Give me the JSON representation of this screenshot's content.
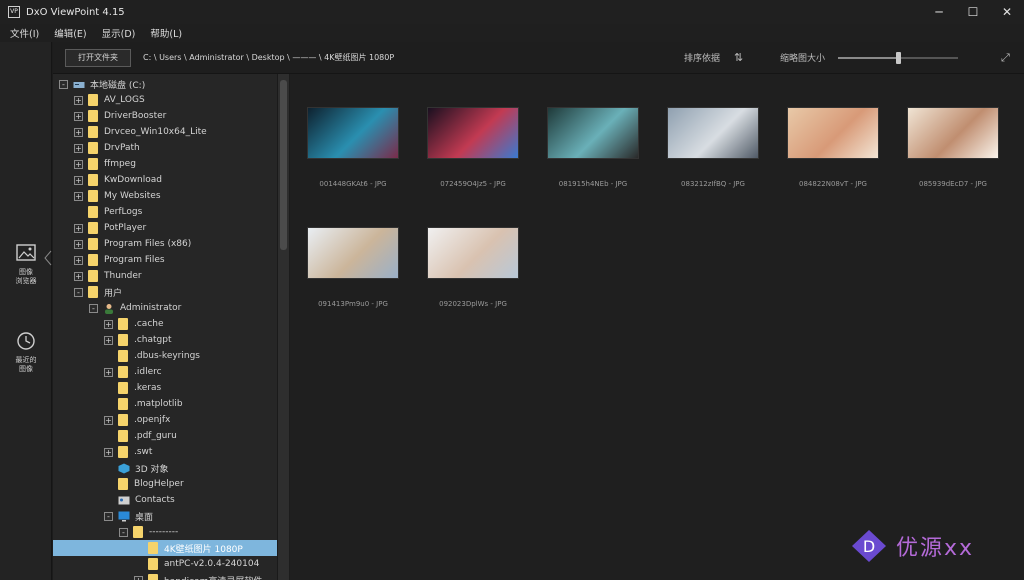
{
  "window": {
    "title": "DxO ViewPoint 4.15",
    "logo_text": "VP",
    "minimize": "─",
    "maximize": "☐",
    "close": "✕"
  },
  "menu": [
    "文件(I)",
    "编辑(E)",
    "显示(D)",
    "帮助(L)"
  ],
  "rail": [
    {
      "label": "图像\n浏览器",
      "icon": "image-icon"
    },
    {
      "label": "最近的\n图像",
      "icon": "history-icon"
    }
  ],
  "toolbar": {
    "open_folder": "打开文件夹",
    "path": "C: \\ Users \\ Administrator \\ Desktop \\ ——— \\ 4K壁纸图片 1080P",
    "sort_label": "排序依据",
    "sort_icon": "⇅",
    "thumb_size_label": "缩略图大小",
    "thumb_size_value": 0.5,
    "fullscreen_icon": "⤢"
  },
  "tree": [
    {
      "indent": 0,
      "exp": "-",
      "icon": "drive",
      "label": "本地磁盘 (C:)"
    },
    {
      "indent": 1,
      "exp": "+",
      "icon": "folder",
      "label": "AV_LOGS"
    },
    {
      "indent": 1,
      "exp": "+",
      "icon": "folder",
      "label": "DriverBooster"
    },
    {
      "indent": 1,
      "exp": "+",
      "icon": "folder",
      "label": "Drvceo_Win10x64_Lite"
    },
    {
      "indent": 1,
      "exp": "+",
      "icon": "folder",
      "label": "DrvPath"
    },
    {
      "indent": 1,
      "exp": "+",
      "icon": "folder",
      "label": "ffmpeg"
    },
    {
      "indent": 1,
      "exp": "+",
      "icon": "folder",
      "label": "KwDownload"
    },
    {
      "indent": 1,
      "exp": "+",
      "icon": "folder",
      "label": "My Websites"
    },
    {
      "indent": 1,
      "exp": "",
      "icon": "folder",
      "label": "PerfLogs"
    },
    {
      "indent": 1,
      "exp": "+",
      "icon": "folder",
      "label": "PotPlayer"
    },
    {
      "indent": 1,
      "exp": "+",
      "icon": "folder",
      "label": "Program Files (x86)"
    },
    {
      "indent": 1,
      "exp": "+",
      "icon": "folder",
      "label": "Program Files"
    },
    {
      "indent": 1,
      "exp": "+",
      "icon": "folder",
      "label": "Thunder"
    },
    {
      "indent": 1,
      "exp": "-",
      "icon": "folder",
      "label": "用户"
    },
    {
      "indent": 2,
      "exp": "-",
      "icon": "user",
      "label": "Administrator"
    },
    {
      "indent": 3,
      "exp": "+",
      "icon": "folder",
      "label": ".cache"
    },
    {
      "indent": 3,
      "exp": "+",
      "icon": "folder",
      "label": ".chatgpt"
    },
    {
      "indent": 3,
      "exp": "",
      "icon": "folder",
      "label": ".dbus-keyrings"
    },
    {
      "indent": 3,
      "exp": "+",
      "icon": "folder",
      "label": ".idlerc"
    },
    {
      "indent": 3,
      "exp": "",
      "icon": "folder",
      "label": ".keras"
    },
    {
      "indent": 3,
      "exp": "",
      "icon": "folder",
      "label": ".matplotlib"
    },
    {
      "indent": 3,
      "exp": "+",
      "icon": "folder",
      "label": ".openjfx"
    },
    {
      "indent": 3,
      "exp": "",
      "icon": "folder",
      "label": ".pdf_guru"
    },
    {
      "indent": 3,
      "exp": "+",
      "icon": "folder",
      "label": ".swt"
    },
    {
      "indent": 3,
      "exp": "",
      "icon": "cube",
      "label": "3D 对象"
    },
    {
      "indent": 3,
      "exp": "",
      "icon": "folder",
      "label": "BlogHelper"
    },
    {
      "indent": 3,
      "exp": "",
      "icon": "contacts",
      "label": "Contacts"
    },
    {
      "indent": 3,
      "exp": "-",
      "icon": "desktop",
      "label": "桌面"
    },
    {
      "indent": 4,
      "exp": "-",
      "icon": "folder",
      "label": "---------"
    },
    {
      "indent": 5,
      "exp": "",
      "icon": "folder",
      "label": "4K壁纸图片 1080P",
      "selected": true
    },
    {
      "indent": 5,
      "exp": "",
      "icon": "folder",
      "label": "antPC-v2.0.4-240104"
    },
    {
      "indent": 5,
      "exp": "+",
      "icon": "folder",
      "label": "bandicam高清录屏软件"
    }
  ],
  "thumbnails": [
    {
      "name": "001448GKAt6 - JPG",
      "colors": [
        "#0e2230",
        "#2a8fb0",
        "#7a2b4a"
      ]
    },
    {
      "name": "072459O4Jz5 - JPG",
      "colors": [
        "#1a1020",
        "#c23a52",
        "#3a7ad0"
      ]
    },
    {
      "name": "081915h4NEb - JPG",
      "colors": [
        "#1f3a3a",
        "#6ab0b8",
        "#2a2a2a"
      ]
    },
    {
      "name": "083212zIfBQ - JPG",
      "colors": [
        "#8fa0b0",
        "#d8dde2",
        "#505a66"
      ]
    },
    {
      "name": "084822N08vT - JPG",
      "colors": [
        "#e8c9a8",
        "#d89a78",
        "#f3e6d6"
      ]
    },
    {
      "name": "085939dEcD7 - JPG",
      "colors": [
        "#f0e4d4",
        "#c08e70",
        "#faf4ec"
      ]
    },
    {
      "name": "091413Pm9u0 - JPG",
      "colors": [
        "#e9eef3",
        "#cbb59a",
        "#9ab0c8"
      ]
    },
    {
      "name": "092023DplWs - JPG",
      "colors": [
        "#f0f0f0",
        "#d9c2b0",
        "#b8c8d8"
      ]
    }
  ],
  "watermark": {
    "text": "优源xx",
    "letter": "D"
  }
}
